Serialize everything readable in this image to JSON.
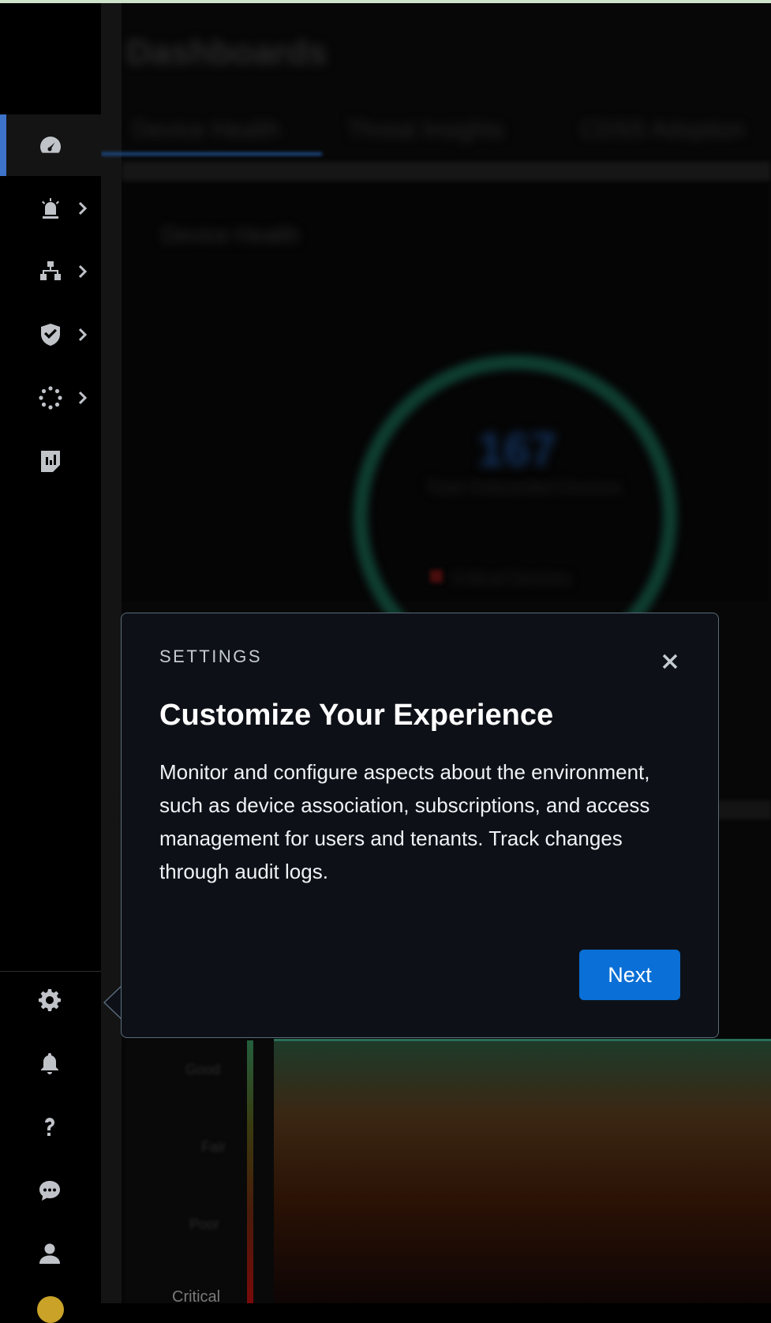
{
  "background": {
    "page_title": "Dashboards",
    "tabs": [
      "Device Health",
      "Threat Insights",
      "CDSS Adoption"
    ],
    "card_title": "Device Health",
    "ring_value": "167",
    "ring_subtitle": "Total Onboarded Devices",
    "ring_legend": "Critical Devices",
    "y_labels": [
      "Good",
      "Fair",
      "Poor",
      "Critical"
    ]
  },
  "sidebar": {
    "nav_items": [
      {
        "icon": "gauge-icon",
        "active": true,
        "has_submenu": false
      },
      {
        "icon": "alarm-icon",
        "active": false,
        "has_submenu": true
      },
      {
        "icon": "network-icon",
        "active": false,
        "has_submenu": true
      },
      {
        "icon": "shield-check-icon",
        "active": false,
        "has_submenu": true
      },
      {
        "icon": "dots-circle-icon",
        "active": false,
        "has_submenu": true
      },
      {
        "icon": "report-icon",
        "active": false,
        "has_submenu": false
      }
    ],
    "utility_items": [
      "gear-icon",
      "bell-icon",
      "help-icon",
      "chat-icon",
      "user-icon"
    ]
  },
  "popover": {
    "eyebrow": "SETTINGS",
    "title": "Customize Your Experience",
    "body": "Monitor and configure aspects about the environment, such as device association, subscriptions, and access management for users and tenants. Track changes through audit logs.",
    "next_label": "Next"
  },
  "colors": {
    "accent": "#0a6fd6",
    "active_indicator": "#3d73c9",
    "popover_bg": "#0d1117"
  }
}
